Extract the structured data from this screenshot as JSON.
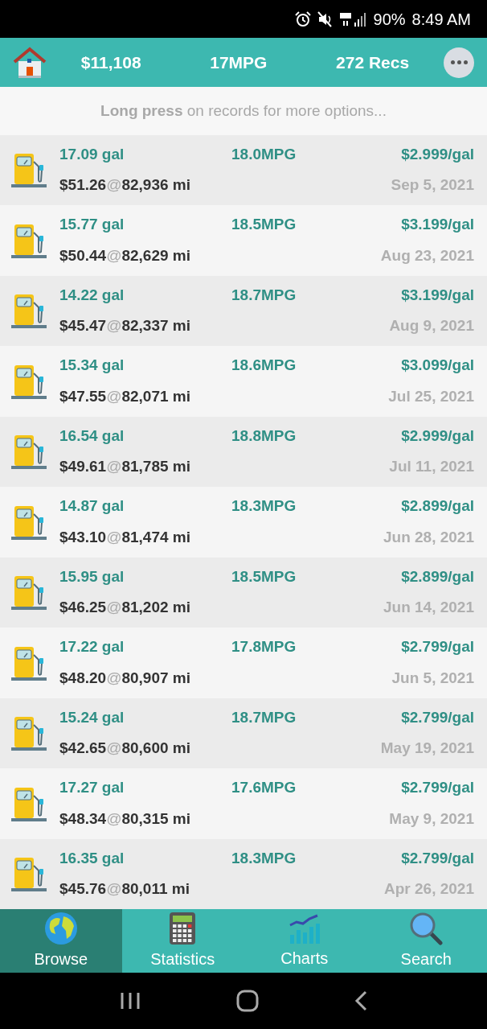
{
  "status_bar": {
    "battery": "90%",
    "time": "8:49 AM"
  },
  "header": {
    "total_cost": "$11,108",
    "mpg": "17MPG",
    "records": "272 Recs"
  },
  "hint": "**Long press** on records for more options...",
  "records": [
    {
      "gallons": "17.09 gal",
      "mpg": "18.0MPG",
      "price": "$2.999/gal",
      "cost": "$51.26",
      "at": "@",
      "odometer": "82,936 mi",
      "date": "Sep 5, 2021"
    },
    {
      "gallons": "15.77 gal",
      "mpg": "18.5MPG",
      "price": "$3.199/gal",
      "cost": "$50.44",
      "at": "@",
      "odometer": "82,629 mi",
      "date": "Aug 23, 2021"
    },
    {
      "gallons": "14.22 gal",
      "mpg": "18.7MPG",
      "price": "$3.199/gal",
      "cost": "$45.47",
      "at": "@",
      "odometer": "82,337 mi",
      "date": "Aug 9, 2021"
    },
    {
      "gallons": "15.34 gal",
      "mpg": "18.6MPG",
      "price": "$3.099/gal",
      "cost": "$47.55",
      "at": "@",
      "odometer": "82,071 mi",
      "date": "Jul 25, 2021"
    },
    {
      "gallons": "16.54 gal",
      "mpg": "18.8MPG",
      "price": "$2.999/gal",
      "cost": "$49.61",
      "at": "@",
      "odometer": "81,785 mi",
      "date": "Jul 11, 2021"
    },
    {
      "gallons": "14.87 gal",
      "mpg": "18.3MPG",
      "price": "$2.899/gal",
      "cost": "$43.10",
      "at": "@",
      "odometer": "81,474 mi",
      "date": "Jun 28, 2021"
    },
    {
      "gallons": "15.95 gal",
      "mpg": "18.5MPG",
      "price": "$2.899/gal",
      "cost": "$46.25",
      "at": "@",
      "odometer": "81,202 mi",
      "date": "Jun 14, 2021"
    },
    {
      "gallons": "17.22 gal",
      "mpg": "17.8MPG",
      "price": "$2.799/gal",
      "cost": "$48.20",
      "at": "@",
      "odometer": "80,907 mi",
      "date": "Jun 5, 2021"
    },
    {
      "gallons": "15.24 gal",
      "mpg": "18.7MPG",
      "price": "$2.799/gal",
      "cost": "$42.65",
      "at": "@",
      "odometer": "80,600 mi",
      "date": "May 19, 2021"
    },
    {
      "gallons": "17.27 gal",
      "mpg": "17.6MPG",
      "price": "$2.799/gal",
      "cost": "$48.34",
      "at": "@",
      "odometer": "80,315 mi",
      "date": "May 9, 2021"
    },
    {
      "gallons": "16.35 gal",
      "mpg": "18.3MPG",
      "price": "$2.799/gal",
      "cost": "$45.76",
      "at": "@",
      "odometer": "80,011 mi",
      "date": "Apr 26, 2021"
    }
  ],
  "tabs": [
    {
      "kind": "globe",
      "label": "Browse",
      "selected": true
    },
    {
      "kind": "calculator",
      "label": "Statistics",
      "selected": false
    },
    {
      "kind": "chart",
      "label": "Charts",
      "selected": false
    },
    {
      "kind": "search",
      "label": "Search",
      "selected": false
    }
  ]
}
